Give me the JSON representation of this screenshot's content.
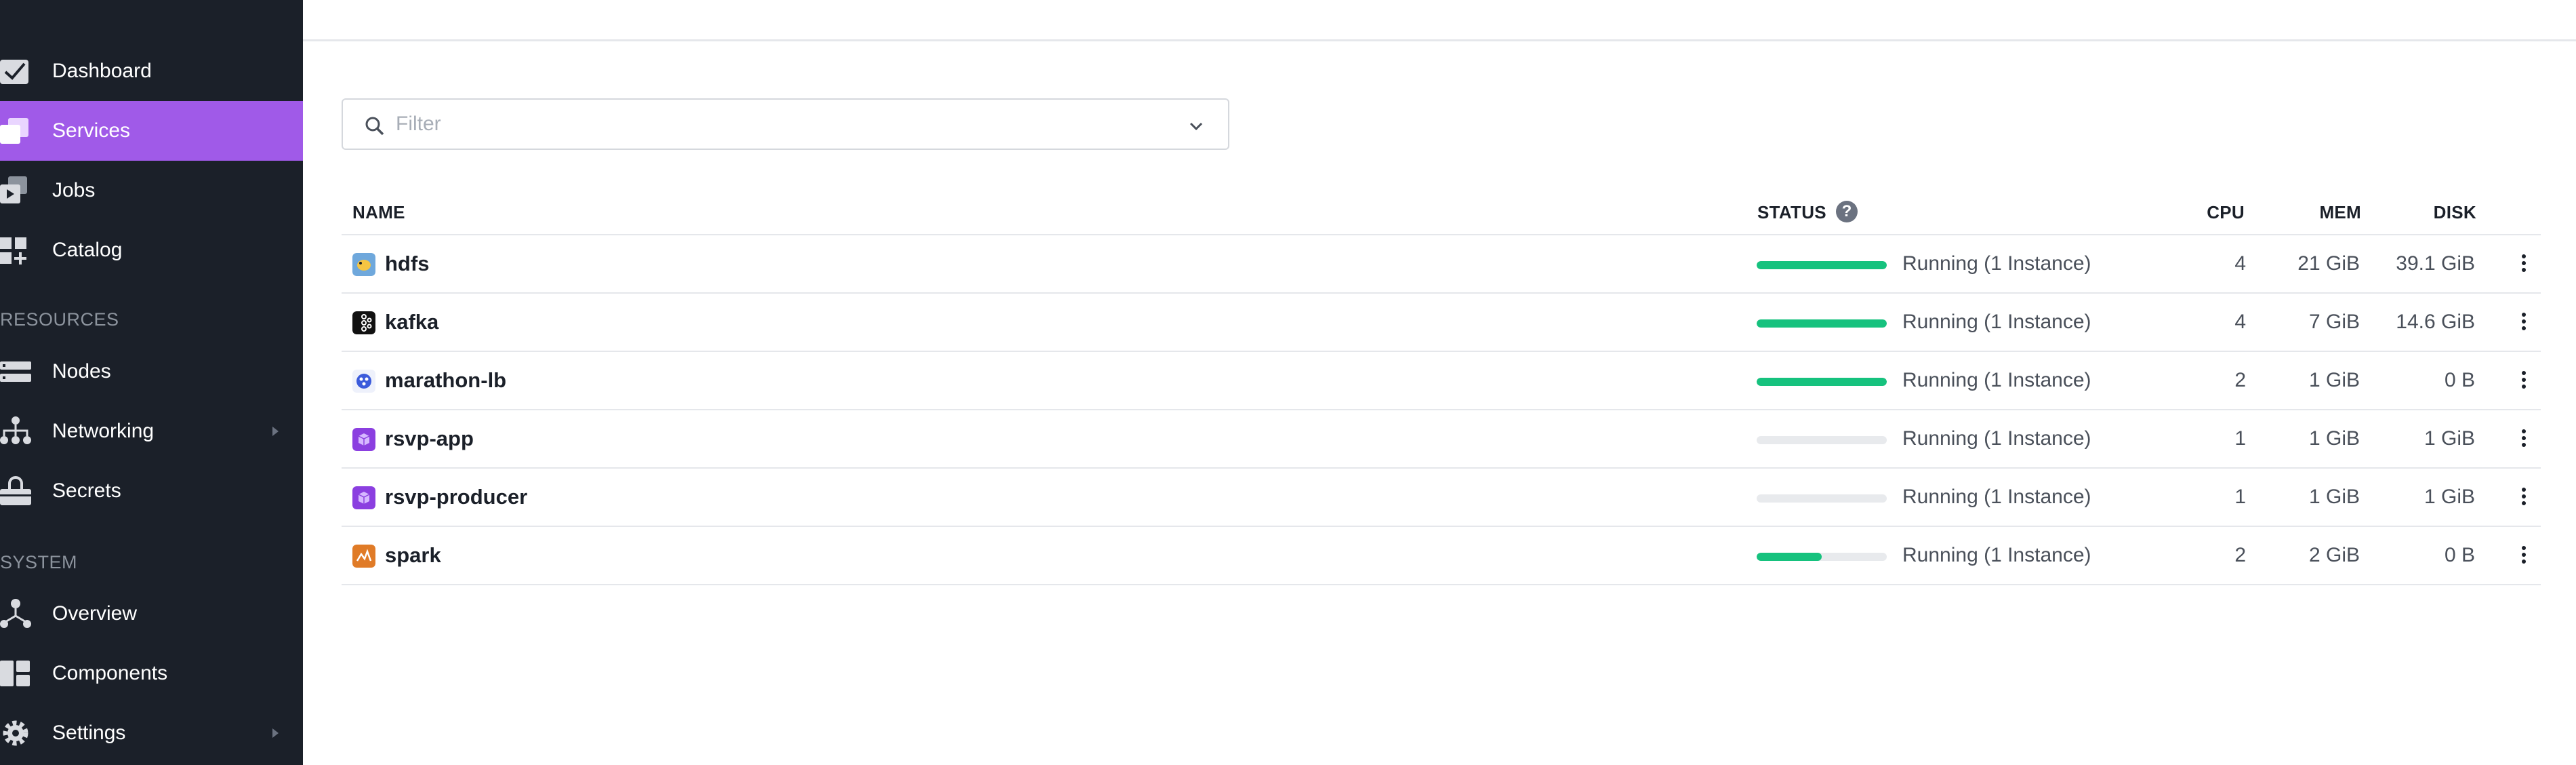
{
  "sidebar": {
    "items": [
      {
        "label": "Dashboard",
        "icon": "dashboard-icon"
      },
      {
        "label": "Services",
        "icon": "services-icon",
        "active": true
      },
      {
        "label": "Jobs",
        "icon": "jobs-icon"
      },
      {
        "label": "Catalog",
        "icon": "catalog-icon"
      }
    ],
    "resources_section": "RESOURCES",
    "resources": [
      {
        "label": "Nodes",
        "icon": "nodes-icon"
      },
      {
        "label": "Networking",
        "icon": "networking-icon",
        "has_submenu": true
      },
      {
        "label": "Secrets",
        "icon": "secrets-icon"
      }
    ],
    "system_section": "SYSTEM",
    "system": [
      {
        "label": "Overview",
        "icon": "overview-icon"
      },
      {
        "label": "Components",
        "icon": "components-icon"
      },
      {
        "label": "Settings",
        "icon": "settings-icon",
        "has_submenu": true
      }
    ]
  },
  "filter": {
    "placeholder": "Filter",
    "value": ""
  },
  "table": {
    "columns": {
      "name": "NAME",
      "status": "STATUS",
      "cpu": "CPU",
      "mem": "MEM",
      "disk": "DISK"
    },
    "rows": [
      {
        "name": "hdfs",
        "icon": "hdfs-icon",
        "status": "Running (1 Instance)",
        "progress": 1.0,
        "cpu": "4",
        "mem": "21 GiB",
        "disk": "39.1 GiB"
      },
      {
        "name": "kafka",
        "icon": "kafka-icon",
        "status": "Running (1 Instance)",
        "progress": 1.0,
        "cpu": "4",
        "mem": "7 GiB",
        "disk": "14.6 GiB"
      },
      {
        "name": "marathon-lb",
        "icon": "marathon-lb-icon",
        "status": "Running (1 Instance)",
        "progress": 1.0,
        "cpu": "2",
        "mem": "1 GiB",
        "disk": "0 B"
      },
      {
        "name": "rsvp-app",
        "icon": "package-icon",
        "status": "Running (1 Instance)",
        "progress": 0.0,
        "cpu": "1",
        "mem": "1 GiB",
        "disk": "1 GiB"
      },
      {
        "name": "rsvp-producer",
        "icon": "package-icon",
        "status": "Running (1 Instance)",
        "progress": 0.0,
        "cpu": "1",
        "mem": "1 GiB",
        "disk": "1 GiB"
      },
      {
        "name": "spark",
        "icon": "spark-icon",
        "status": "Running (1 Instance)",
        "progress": 0.5,
        "cpu": "2",
        "mem": "2 GiB",
        "disk": "0 B"
      }
    ]
  },
  "colors": {
    "sidebar_bg": "#1b2029",
    "active": "#a05ae8",
    "progress": "#16c27e"
  }
}
